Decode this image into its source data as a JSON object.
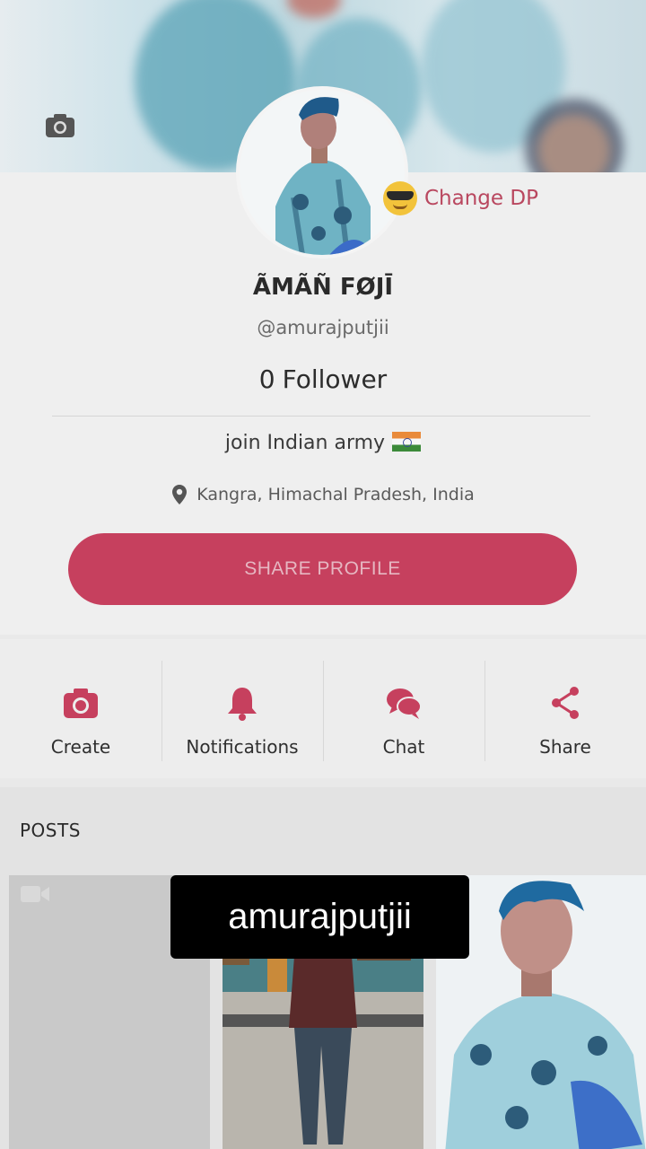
{
  "profile": {
    "name": "ÃMÃÑ FØJĪ",
    "handle": "@amurajputjii",
    "followers_count": "0",
    "followers_label": "Follower",
    "bio": "join Indian army",
    "location": "Kangra, Himachal Pradesh, India",
    "change_dp_label": "Change DP",
    "share_profile_label": "SHARE PROFILE"
  },
  "actions": [
    {
      "label": "Create",
      "icon": "camera-icon"
    },
    {
      "label": "Notifications",
      "icon": "bell-icon"
    },
    {
      "label": "Chat",
      "icon": "chat-bubbles-icon"
    },
    {
      "label": "Share",
      "icon": "share-icon"
    }
  ],
  "posts": {
    "title": "POSTS"
  },
  "overlay": {
    "username": "amurajputjii"
  },
  "colors": {
    "accent": "#c6405e",
    "accent_text": "#b9475f",
    "background": "#e9e9e9"
  }
}
